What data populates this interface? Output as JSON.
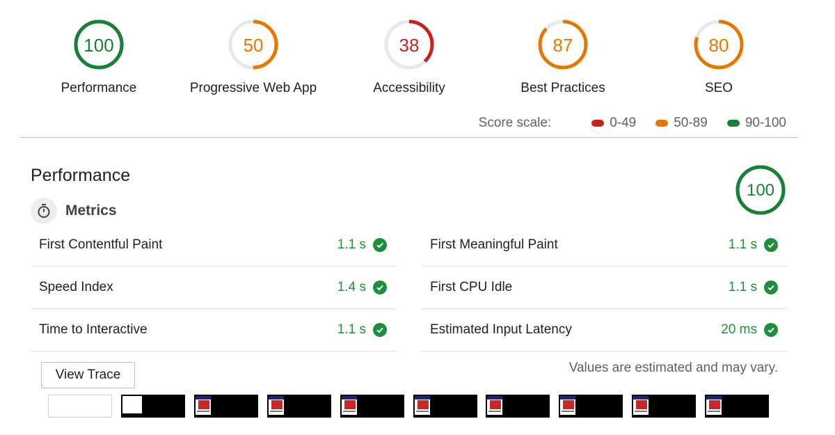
{
  "categories": [
    {
      "label": "Performance",
      "score": "100",
      "value": 100,
      "color": "#188038",
      "track": "#188038"
    },
    {
      "label": "Progressive Web App",
      "score": "50",
      "value": 50,
      "color": "#e67700",
      "track": "#e8e8e8"
    },
    {
      "label": "Accessibility",
      "score": "38",
      "value": 38,
      "color": "#c5221f",
      "track": "#e8e8e8"
    },
    {
      "label": "Best Practices",
      "score": "87",
      "value": 87,
      "color": "#e67700",
      "track": "#e8e8e8"
    },
    {
      "label": "SEO",
      "score": "80",
      "value": 80,
      "color": "#e67700",
      "track": "#e8e8e8"
    }
  ],
  "score_scale": {
    "label": "Score scale:",
    "ranges": [
      {
        "label": "0-49",
        "color": "#c5221f"
      },
      {
        "label": "50-89",
        "color": "#e67700"
      },
      {
        "label": "90-100",
        "color": "#188038"
      }
    ]
  },
  "performance": {
    "title": "Performance",
    "score": "100",
    "value": 100,
    "color": "#188038",
    "metrics_title": "Metrics",
    "metrics_icon": "stopwatch-icon",
    "metrics_left": [
      {
        "name": "First Contentful Paint",
        "value": "1.1 s"
      },
      {
        "name": "Speed Index",
        "value": "1.4 s"
      },
      {
        "name": "Time to Interactive",
        "value": "1.1 s"
      }
    ],
    "metrics_right": [
      {
        "name": "First Meaningful Paint",
        "value": "1.1 s"
      },
      {
        "name": "First CPU Idle",
        "value": "1.1 s"
      },
      {
        "name": "Estimated Input Latency",
        "value": "20 ms"
      }
    ],
    "pass_icon": "check-circle-icon",
    "pass_color": "#1e8e3e",
    "view_trace_label": "View Trace",
    "estimate_note": "Values are estimated and may vary."
  },
  "filmstrip_frames": [
    "blank",
    "early",
    "loaded",
    "loaded",
    "loaded",
    "loaded",
    "loaded",
    "loaded",
    "loaded",
    "loaded"
  ]
}
